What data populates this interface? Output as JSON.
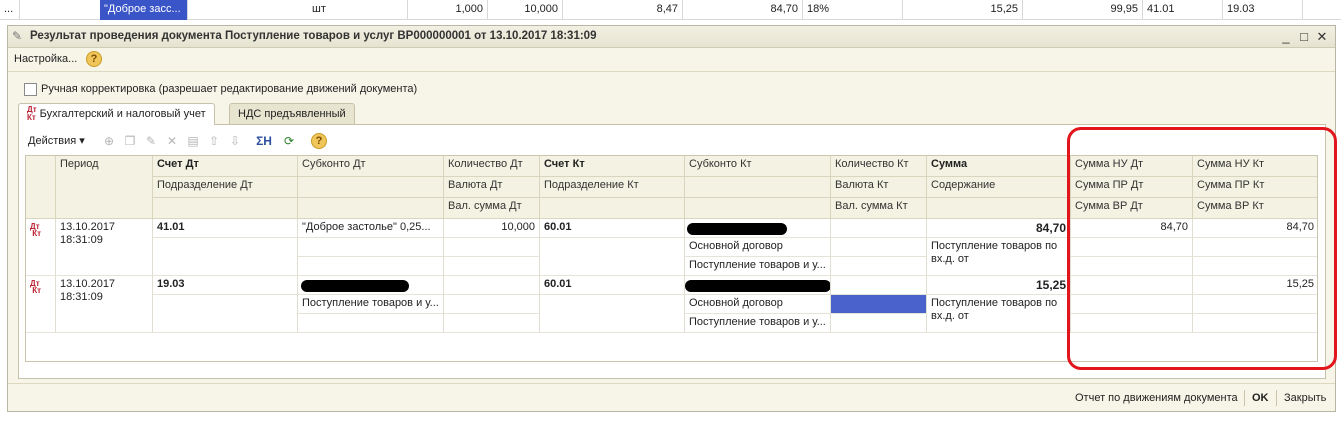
{
  "background_row": {
    "cells": [
      "...",
      "\"Доброе засс...",
      "шт",
      "1,000",
      "10,000",
      "8,47",
      "84,70",
      "18%",
      "15,25",
      "99,95",
      "41.01",
      "19.03"
    ]
  },
  "window": {
    "title": "Результат проведения документа Поступление товаров и услуг ВР000000001 от 13.10.2017 18:31:09",
    "minimize": "_",
    "maximize": "□",
    "close": "✕"
  },
  "toolbar_top": {
    "settings": "Настройка...",
    "help": "?"
  },
  "manual_correction": {
    "label": "Ручная корректировка (разрешает редактирование движений документа)"
  },
  "tabs": [
    {
      "label": "Бухгалтерский и налоговый учет",
      "icon_top": "Дт",
      "icon_bottom": "Кт"
    },
    {
      "label": "НДС предъявленный"
    }
  ],
  "actions_bar": {
    "label": "Действия ▾",
    "sigma": "ΣН",
    "help": "?"
  },
  "grid": {
    "headers": {
      "period": "Период",
      "acc_dt": "Счет Дт",
      "sub_dt": "Субконто Дт",
      "qty_dt": "Количество Дт",
      "acc_kt": "Счет Кт",
      "sub_kt": "Субконто Кт",
      "qty_kt": "Количество Кт",
      "sum": "Сумма",
      "nu_dt": "Сумма НУ Дт",
      "nu_kt": "Сумма НУ Кт",
      "dept_dt": "Подразделение Дт",
      "cur_dt": "Валюта Дт",
      "dept_kt": "Подразделение Кт",
      "cur_kt": "Валюта Кт",
      "content": "Содержание",
      "pr_dt": "Сумма ПР Дт",
      "pr_kt": "Сумма ПР Кт",
      "cur_sum_dt": "Вал. сумма Дт",
      "cur_sum_kt": "Вал. сумма Кт",
      "vr_dt": "Сумма ВР Дт",
      "vr_kt": "Сумма ВР Кт"
    },
    "rows": [
      {
        "icon_top": "Дт",
        "icon_bottom": "Кт",
        "period": "13.10.2017",
        "period_time": "18:31:09",
        "acc_dt": "41.01",
        "sub_dt": "\"Доброе застолье\" 0,25...",
        "qty_dt": "10,000",
        "acc_kt": "60.01",
        "sub_kt_2": "Основной договор",
        "sub_kt_3": "Поступление товаров и у...",
        "sum": "84,70",
        "content": "Поступление товаров по вх.д. от",
        "nu_dt": "84,70",
        "nu_kt": "84,70"
      },
      {
        "icon_top": "Дт",
        "icon_bottom": "Кт",
        "period": "13.10.2017",
        "period_time": "18:31:09",
        "acc_dt": "19.03",
        "sub_dt_2": "Поступление товаров и у...",
        "acc_kt": "60.01",
        "sub_kt_2": "Основной договор",
        "sub_kt_3": "Поступление товаров и у...",
        "sum": "15,25",
        "content": "Поступление товаров по вх.д. от",
        "nu_kt": "15,25"
      }
    ]
  },
  "status_bar": {
    "report": "Отчет по движениям документа",
    "ok": "OK",
    "close": "Закрыть"
  },
  "colors": {
    "highlight": "#e2151d",
    "selection": "#4a63cc",
    "window_bg": "#f7f5e8"
  }
}
